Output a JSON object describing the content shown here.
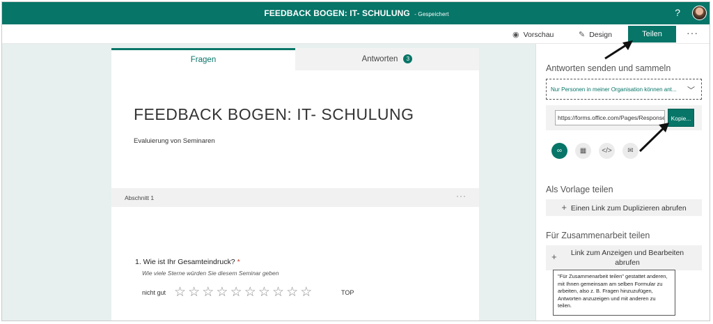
{
  "header": {
    "title": "FEEDBACK BOGEN: IT- SCHULUNG",
    "saved_status": "- Gespeichert",
    "help_label": "?"
  },
  "toolbar": {
    "preview_label": "Vorschau",
    "design_label": "Design",
    "share_label": "Teilen",
    "more_label": "···"
  },
  "tabs": {
    "questions_label": "Fragen",
    "responses_label": "Antworten",
    "responses_count": "3"
  },
  "form": {
    "title": "FEEDBACK BOGEN: IT- SCHULUNG",
    "description": "Evaluierung von Seminaren",
    "section_label": "Abschnitt 1",
    "section_menu": "···"
  },
  "question": {
    "title": "1. Wie ist Ihr Gesamteindruck?",
    "required_mark": "*",
    "subtitle": "Wie viele Sterne würden Sie diesem Seminar geben",
    "low_label": "nicht gut",
    "high_label": "TOP",
    "stars_total": 10,
    "stars_selected": 0
  },
  "share_panel": {
    "send_heading": "Antworten senden und sammeln",
    "permission_value": "Nur Personen in meiner Organisation können ant...",
    "link_value": "https://forms.office.com/Pages/ResponsePage.aspx",
    "copy_label": "Kopie...",
    "template_heading": "Als Vorlage teilen",
    "duplicate_link_label": "Einen Link zum Duplizieren abrufen",
    "collab_heading": "Für Zusammenarbeit teilen",
    "edit_link_label": "Link zum Anzeigen und Bearbeiten abrufen",
    "tooltip_text": "\"Für Zusammenarbeit teilen\" gestattet anderen, mit Ihnen gemeinsam am selben Formular zu arbeiten, also z. B. Fragen hinzuzufügen, Antworten anzuzeigen und mit anderen zu teilen.",
    "icons": [
      "link-icon",
      "qr-code-icon",
      "embed-icon",
      "email-icon"
    ]
  },
  "colors": {
    "accent": "#077568",
    "workspace_bg": "#e7f0ef"
  }
}
